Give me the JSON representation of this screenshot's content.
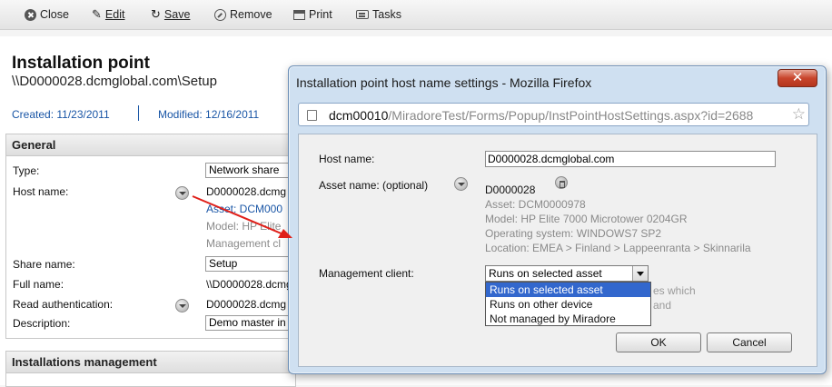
{
  "toolbar": {
    "close": "Close",
    "edit": "Edit",
    "save": "Save",
    "remove": "Remove",
    "print": "Print",
    "tasks": "Tasks"
  },
  "page": {
    "title": "Installation point",
    "subtitle": "\\\\D0000028.dcmglobal.com\\Setup",
    "created": "Created: 11/23/2011",
    "modified": "Modified: 12/16/2011"
  },
  "general": {
    "heading": "General",
    "type_label": "Type:",
    "type_value": "Network share",
    "host_label": "Host name:",
    "host_value": "D0000028.dcmg",
    "host_asset": "Asset: DCM000",
    "host_model": "Model: HP Elite",
    "host_mgmt": "Management cl",
    "share_label": "Share name:",
    "share_value": "Setup",
    "full_label": "Full name:",
    "full_value": "\\\\D0000028.dcmg",
    "read_label": "Read authentication:",
    "read_value": "D0000028.dcmg",
    "desc_label": "Description:",
    "desc_value": "Demo master in"
  },
  "installations": {
    "heading": "Installations management"
  },
  "popup": {
    "title": "Installation point host name settings - Mozilla Firefox",
    "close_glyph": "✕",
    "url_domain": "dcm00010",
    "url_path": "/MiradoreTest/Forms/Popup/InstPointHostSettings.aspx?id=2688",
    "star_glyph": "☆",
    "host_label": "Host name:",
    "host_value": "D0000028.dcmglobal.com",
    "asset_label": "Asset name: (optional)",
    "asset_value": "D0000028",
    "asset_line": "Asset: DCM0000978",
    "model_line": "Model: HP Elite 7000 Microtower 0204GR",
    "os_line": "Operating system: WINDOWS7 SP2",
    "location_line": "Location: EMEA > Finland > Lappeenranta > Skinnarila",
    "mgmt_label": "Management client:",
    "mgmt_selected": "Runs on selected asset",
    "mgmt_options": [
      "Runs on selected asset",
      "Runs on other device",
      "Not managed by Miradore"
    ],
    "behind_1": "es which",
    "behind_2": "and",
    "ok": "OK",
    "cancel": "Cancel"
  },
  "colors": {
    "link": "#1a56a6",
    "selection": "#3267cd",
    "arrow": "#e0201a"
  }
}
